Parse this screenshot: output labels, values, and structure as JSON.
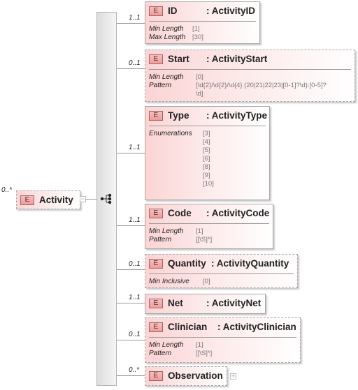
{
  "root": {
    "multiplicity": "0..*",
    "badge": "E",
    "name": "Activity"
  },
  "children": [
    {
      "badge": "E",
      "name": "ID",
      "type": ": ActivityID",
      "multiplicity": "1..1",
      "optional": false,
      "facets": [
        {
          "label": "Min Length",
          "values": [
            "[1]"
          ]
        },
        {
          "label": "Max Length",
          "values": [
            "[30]"
          ]
        }
      ]
    },
    {
      "badge": "E",
      "name": "Start",
      "type": ": ActivityStart",
      "multiplicity": "0..1",
      "optional": true,
      "facets": [
        {
          "label": "Min Length",
          "values": [
            "[0]"
          ]
        },
        {
          "label": "Pattern",
          "values": [
            "[\\d{2}/\\d{2}/\\d{4} (20|21|22|23|[0-1]?\\d):[0-5]?",
            "\\d]"
          ]
        }
      ]
    },
    {
      "badge": "E",
      "name": "Type",
      "type": ": ActivityType",
      "multiplicity": "1..1",
      "optional": false,
      "facets": [
        {
          "label": "Enumerations",
          "values": [
            "[3]",
            "[4]",
            "[5]",
            "[6]",
            "[8]",
            "[9]",
            "[10]"
          ]
        }
      ]
    },
    {
      "badge": "E",
      "name": "Code",
      "type": ": ActivityCode",
      "multiplicity": "1..1",
      "optional": false,
      "facets": [
        {
          "label": "Min Length",
          "values": [
            "[1]"
          ]
        },
        {
          "label": "Pattern",
          "values": [
            "[[\\S]*]"
          ]
        }
      ]
    },
    {
      "badge": "E",
      "name": "Quantity",
      "type": ": ActivityQuantity",
      "multiplicity": "0..1",
      "optional": true,
      "facets": [
        {
          "label": "Min Inclusive",
          "values": [
            "[0]"
          ]
        }
      ]
    },
    {
      "badge": "E",
      "name": "Net",
      "type": ": ActivityNet",
      "multiplicity": "1..1",
      "optional": false,
      "facets": []
    },
    {
      "badge": "E",
      "name": "Clinician",
      "type": ": ActivityClinician",
      "multiplicity": "0..1",
      "optional": true,
      "facets": [
        {
          "label": "Min Length",
          "values": [
            "[1]"
          ]
        },
        {
          "label": "Pattern",
          "values": [
            "[[\\S]*]"
          ]
        }
      ]
    },
    {
      "badge": "E",
      "name": "Observation",
      "type": "",
      "multiplicity": "0..*",
      "optional": true,
      "facets": [],
      "expandable": true
    }
  ]
}
